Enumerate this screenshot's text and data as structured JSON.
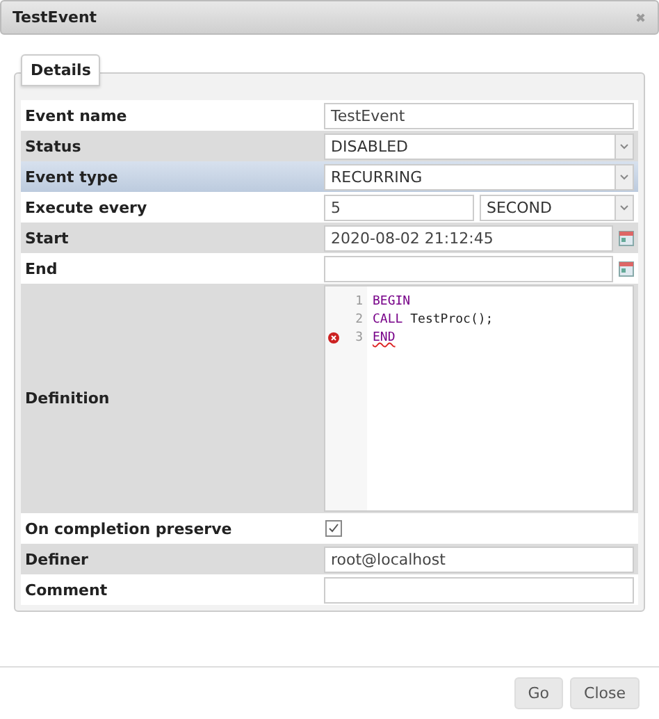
{
  "window": {
    "title": "TestEvent",
    "close_icon": "✖"
  },
  "tab": {
    "label": "Details",
    "selected": true
  },
  "rows": [
    {
      "label": "Event name",
      "kind": "text",
      "value": "TestEvent",
      "shaded": false,
      "selected": false
    },
    {
      "label": "Status",
      "kind": "select",
      "value": "DISABLED",
      "shaded": true,
      "selected": false
    },
    {
      "label": "Event type",
      "kind": "select",
      "value": "RECURRING",
      "shaded": false,
      "selected": true
    },
    {
      "label": "Execute every",
      "kind": "interval",
      "value": "5",
      "unit": "SECOND",
      "shaded": false,
      "selected": false
    },
    {
      "label": "Start",
      "kind": "date",
      "value": "2020-08-02 21:12:45",
      "shaded": true,
      "selected": false
    },
    {
      "label": "End",
      "kind": "date",
      "value": "",
      "shaded": false,
      "selected": false
    },
    {
      "label": "Definition",
      "kind": "code",
      "shaded": true,
      "selected": false,
      "lines": [
        {
          "number": "1",
          "error": false,
          "tokens": [
            {
              "text": "BEGIN",
              "kind": "keyword"
            }
          ]
        },
        {
          "number": "2",
          "error": false,
          "tokens": [
            {
              "text": "CALL",
              "kind": "keyword"
            },
            {
              "text": " TestProc();",
              "kind": "plain"
            }
          ]
        },
        {
          "number": "3",
          "error": true,
          "tokens": [
            {
              "text": "END",
              "kind": "keyword"
            }
          ]
        }
      ]
    },
    {
      "label": "On completion preserve",
      "kind": "checkbox",
      "checked": true,
      "shaded": false,
      "selected": false
    },
    {
      "label": "Definer",
      "kind": "text",
      "value": "root@localhost",
      "shaded": true,
      "selected": false
    },
    {
      "label": "Comment",
      "kind": "text",
      "value": "",
      "shaded": false,
      "selected": false
    }
  ],
  "buttons": [
    "Go",
    "Close"
  ]
}
